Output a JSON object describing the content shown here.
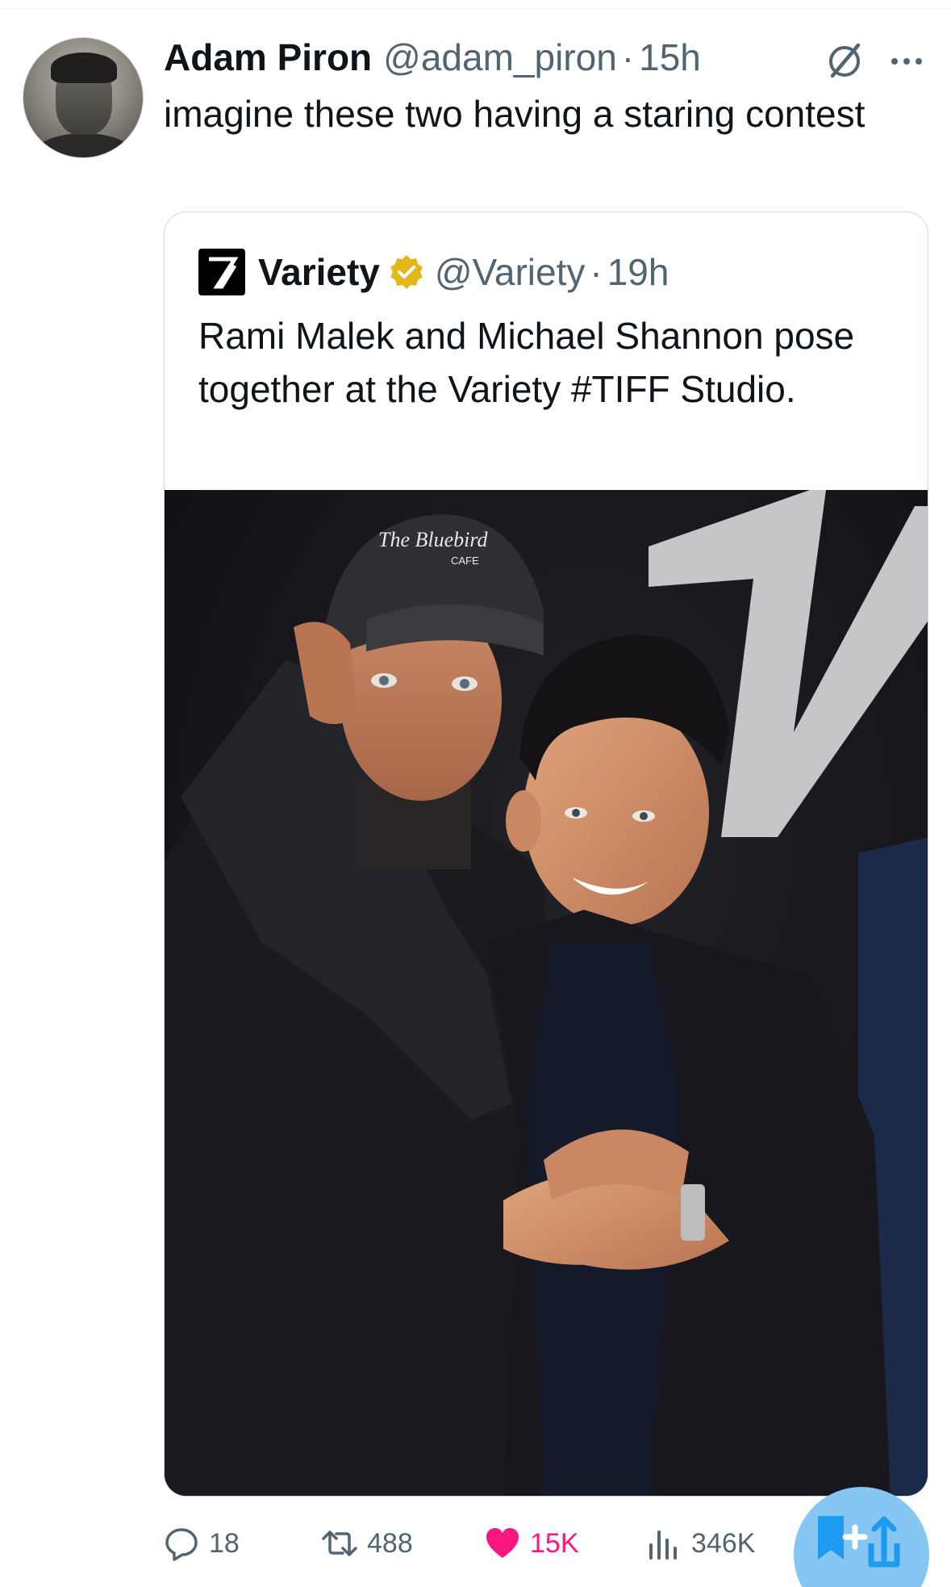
{
  "tweet": {
    "author": {
      "display_name": "Adam Piron",
      "handle": "@adam_piron",
      "separator": "·",
      "time": "15h"
    },
    "text": "imagine these two having a staring contest"
  },
  "quote": {
    "author": {
      "display_name": "Variety",
      "handle": "@Variety",
      "separator": "·",
      "time": "19h",
      "verified": true
    },
    "text": "Rami Malek and Michael Shannon pose together at the Variety #TIFF Studio.",
    "photo": {
      "cap_text_main": "The Bluebird",
      "cap_text_sub": "CAFE",
      "backdrop_logo": "V"
    }
  },
  "actions": {
    "replies": "18",
    "reposts": "488",
    "likes": "15K",
    "views": "346K"
  },
  "icons": {
    "grok": "grok-icon",
    "more": "more-options-icon",
    "reply": "reply-icon",
    "repost": "repost-icon",
    "like": "heart-icon",
    "views": "views-icon",
    "compose": "compose-fab-icon"
  },
  "colors": {
    "text_primary": "#0f1419",
    "text_secondary": "#536471",
    "like_pink": "#f91880",
    "verified_gold": "#e2b719",
    "fab_blue": "#85c6f3",
    "border": "#cfd9de"
  }
}
